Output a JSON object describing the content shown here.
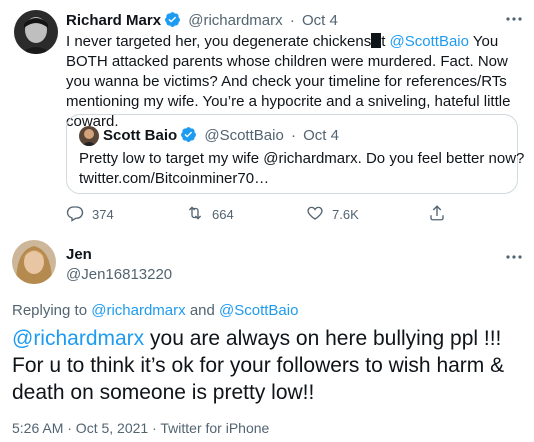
{
  "tweet": {
    "author_name": "Richard Marx",
    "author_handle": "@richardmarx",
    "dot": "·",
    "date": "Oct 4",
    "text_part1": "I never targeted her, you degenerate chickens",
    "text_part2": "t ",
    "mention": "@ScottBaio",
    "text_part3": " You BOTH attacked parents whose children were murdered. Fact. Now you wanna be victims? And check your timeline for references/RTs mentioning my wife. You’re a hypocrite and a sniveling, hateful little coward.",
    "quote": {
      "author_name": "Scott Baio",
      "author_handle": "@ScottBaio",
      "date": "Oct 4",
      "text_line1": "Pretty low to target my wife @richardmarx. Do you feel better now?",
      "text_line2": "twitter.com/Bitcoinminer70…"
    },
    "actions": {
      "replies": "374",
      "retweets": "664",
      "likes": "7.6K"
    }
  },
  "reply": {
    "author_name": "Jen",
    "author_handle": "@Jen16813220",
    "replying_prefix": "Replying to",
    "replying_user1": "@richardmarx",
    "replying_and": "and",
    "replying_user2": "@ScottBaio",
    "mention": "@richardmarx",
    "text": " you are always on here bullying ppl !!! For u to think it’s ok for your followers to wish harm & death on someone is pretty low!!",
    "timestamp": "5:26 AM · Oct 5, 2021 · Twitter for iPhone"
  },
  "colors": {
    "accent": "#1d9bf0",
    "text": "#0f1419",
    "muted": "#536471"
  }
}
